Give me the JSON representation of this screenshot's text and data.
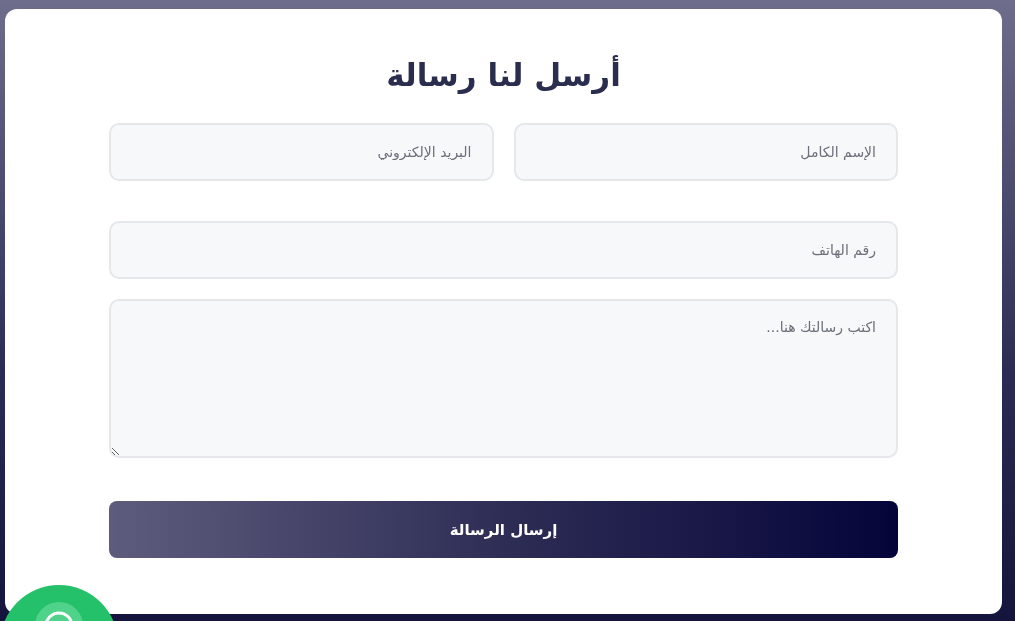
{
  "title": "أرسل لنا رسالة",
  "fields": [
    {
      "kind": "input",
      "placeholder": "الإسم الكامل"
    },
    {
      "kind": "input",
      "placeholder": "البريد الإلكتروني"
    },
    {
      "kind": "input",
      "placeholder": "رقم الهاتف"
    },
    {
      "kind": "textarea",
      "placeholder": "اكتب رسالتك هنا..."
    }
  ],
  "submit": "إرسال الرسالة",
  "chat_button": {
    "kind": "whatsapp"
  }
}
